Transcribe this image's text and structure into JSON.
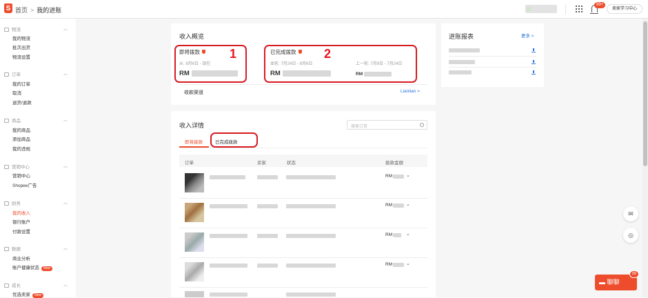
{
  "header": {
    "home": "首页",
    "separator": ">",
    "title": "我的进账",
    "badge": "99+",
    "learn": "卖家学习中心",
    "logo": "S"
  },
  "sidebar": {
    "sections": [
      {
        "title": "物流",
        "items": [
          "我的物流",
          "批次出货",
          "物流设置"
        ]
      },
      {
        "title": "订单",
        "items": [
          "我的订单",
          "取消",
          "退货/退款"
        ]
      },
      {
        "title": "商品",
        "items": [
          "我的商品",
          "添加商品",
          "我的违规"
        ]
      },
      {
        "title": "营销中心",
        "items": [
          "营销中心",
          "Shopee广告"
        ]
      },
      {
        "title": "财务",
        "items": [
          "我的收入",
          "银行账户",
          "付款设置"
        ]
      },
      {
        "title": "数据",
        "items": [
          "商业分析",
          "账户健康状态"
        ]
      },
      {
        "title": "成长",
        "items": [
          "优选卖家"
        ]
      }
    ],
    "new_badge": "New"
  },
  "overview": {
    "title": "收入概览",
    "pending": {
      "label": "即将拨款",
      "range": "从: 8月6日 - 现在",
      "amount": "RM"
    },
    "released": {
      "label": "已完成拨款",
      "this_week": "本轮: 7月24日 - 8月6日",
      "last_week": "上一轮: 7月9日 - 7月24日",
      "amount1": "RM",
      "amount2": "RM"
    },
    "channel": "收款渠道",
    "channel_value": "Lianlian >"
  },
  "annotations": {
    "n1": "1",
    "n2": "2"
  },
  "reports": {
    "title": "进账报表",
    "more": "更多 >"
  },
  "details": {
    "title": "收入详情",
    "search_placeholder": "搜索订单",
    "tabs": [
      "即将拨款",
      "已完成拨款"
    ],
    "columns": [
      "订单",
      "买家",
      "状态",
      "拨款金额"
    ],
    "row_amount": "RM"
  },
  "chat": {
    "label": "聊聊",
    "badge": "99"
  }
}
